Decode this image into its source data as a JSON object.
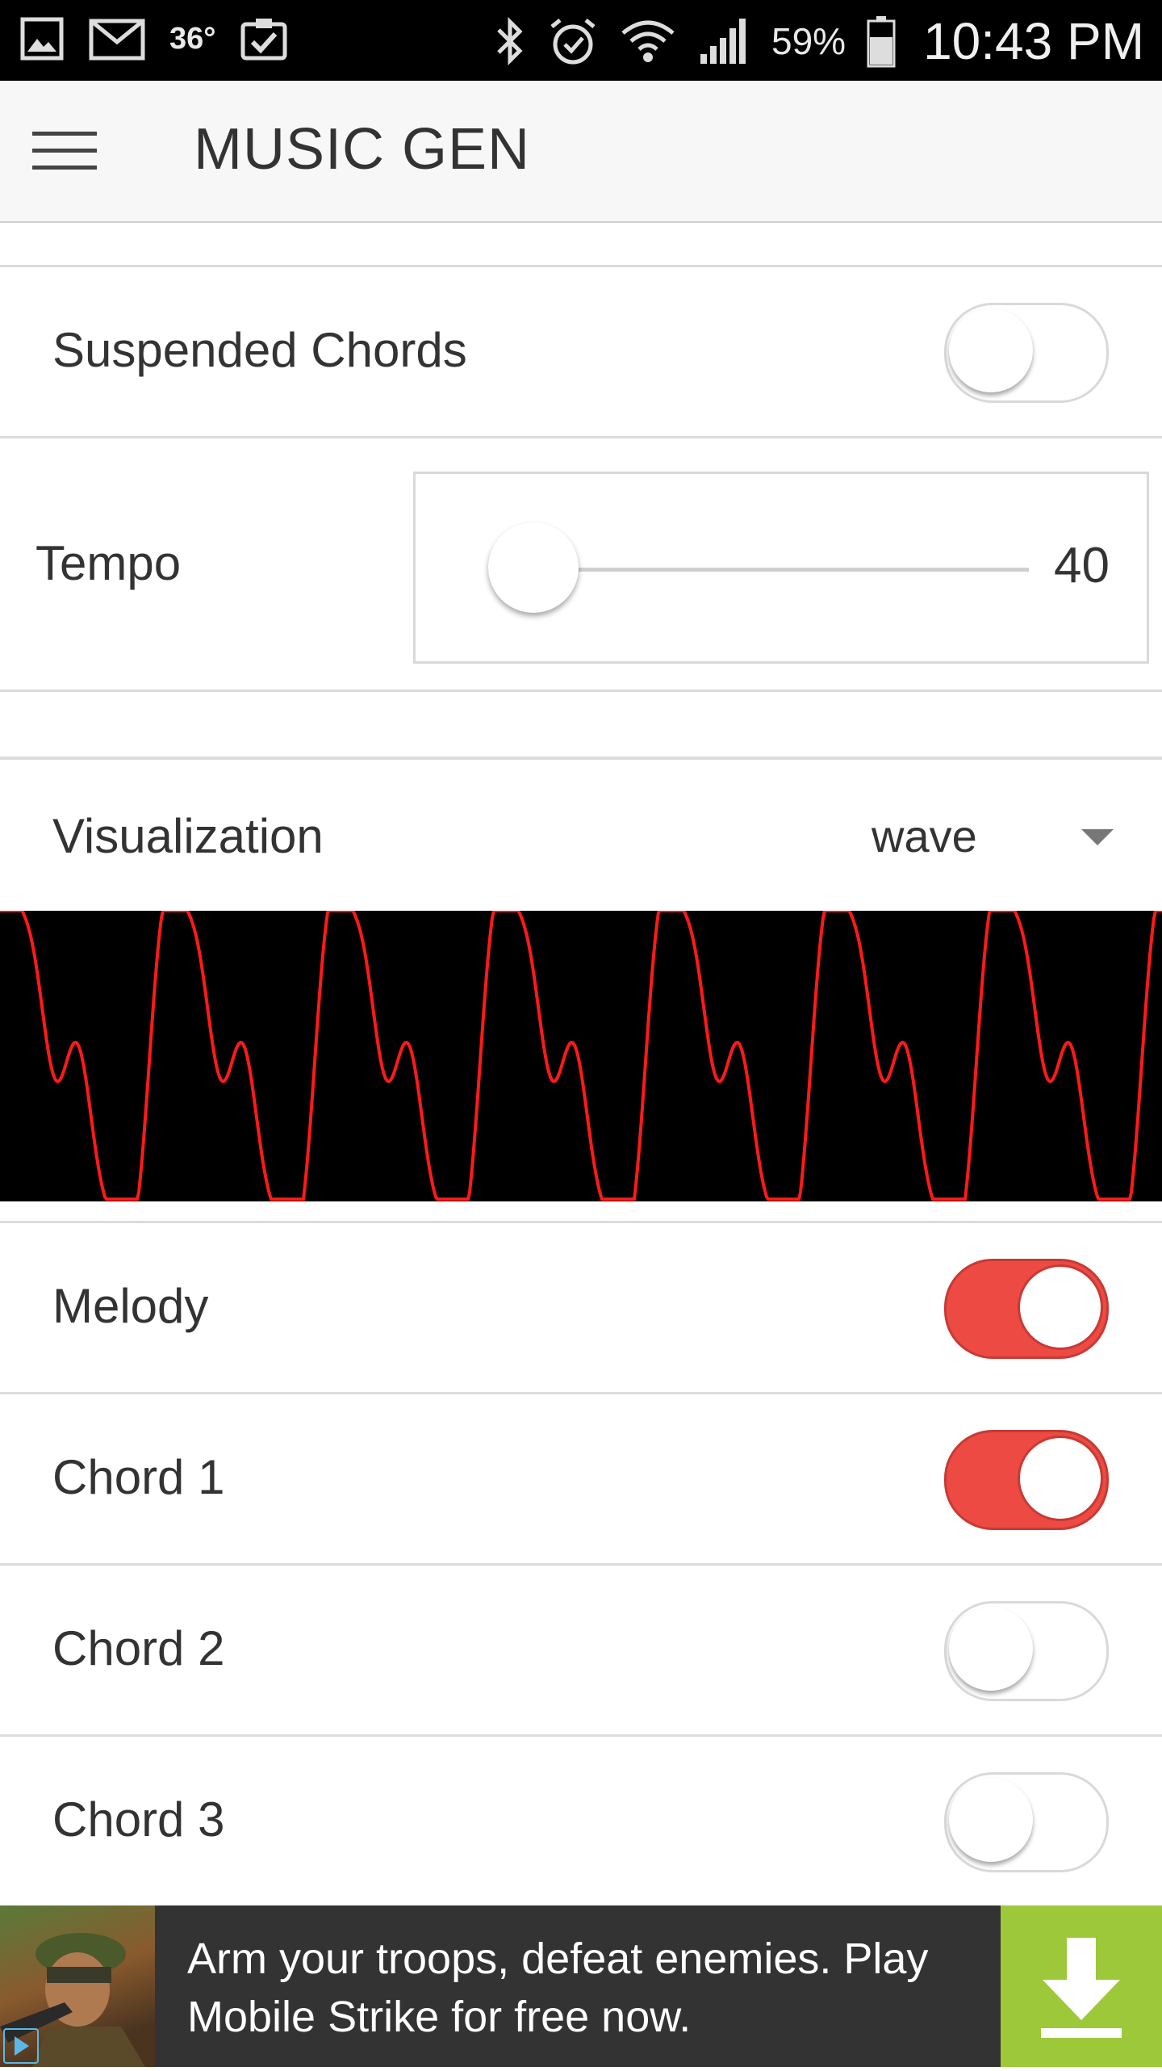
{
  "status_bar": {
    "temperature": "36°",
    "battery": "59%",
    "time": "10:43 PM"
  },
  "app_bar": {
    "title": "MUSIC GEN"
  },
  "settings": {
    "suspended_chords": {
      "label": "Suspended Chords",
      "on": false
    },
    "tempo": {
      "label": "Tempo",
      "value": "40"
    },
    "visualization": {
      "label": "Visualization",
      "value": "wave"
    }
  },
  "tracks": [
    {
      "label": "Melody",
      "on": true
    },
    {
      "label": "Chord 1",
      "on": true
    },
    {
      "label": "Chord 2",
      "on": false
    },
    {
      "label": "Chord 3",
      "on": false
    }
  ],
  "colors": {
    "accent": "#ee4a44",
    "wave_line": "#ff1a1a",
    "wave_bg": "#000000",
    "ad_button": "#9dc83a"
  },
  "ad": {
    "text": "Arm your troops, defeat enemies. Play Mobile Strike for free now.",
    "icon": "download-icon"
  }
}
